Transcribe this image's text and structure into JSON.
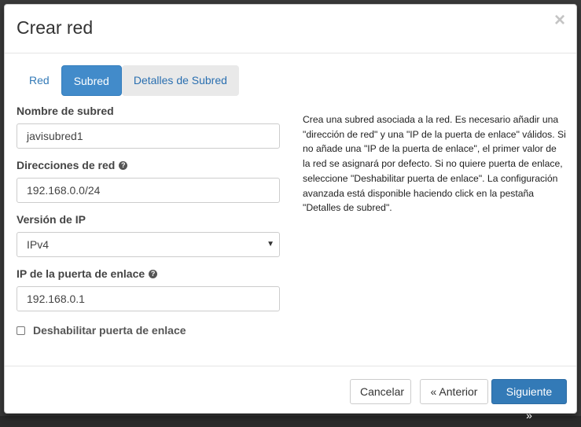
{
  "modal": {
    "title": "Crear red",
    "close_symbol": "×"
  },
  "tabs": [
    {
      "label": "Red",
      "active": false
    },
    {
      "label": "Subred",
      "active": true
    },
    {
      "label": "Detalles de Subred",
      "active": false
    }
  ],
  "form": {
    "subnet_name": {
      "label": "Nombre de subred",
      "value": "javisubred1"
    },
    "network_address": {
      "label": "Direcciones de red",
      "value": "192.168.0.0/24",
      "help_icon": "question-circle-icon"
    },
    "ip_version": {
      "label": "Versión de IP",
      "value": "IPv4"
    },
    "gateway_ip": {
      "label": "IP de la puerta de enlace",
      "value": "192.168.0.1",
      "help_icon": "question-circle-icon"
    },
    "disable_gateway": {
      "label": "Deshabilitar puerta de enlace",
      "checked": false
    }
  },
  "help_text": "Crea una subred asociada a la red. Es necesario añadir una \"dirección de red\" y una \"IP de la puerta de enlace\" válidos. Si no añade una \"IP de la puerta de enlace\", el primer valor de la red se asignará por defecto. Si no quiere puerta de enlace, seleccione \"Deshabilitar puerta de enlace\". La configuración avanzada está disponible haciendo click en la pestaña \"Detalles de subred\".",
  "footer": {
    "cancel_label": "Cancelar",
    "back_label": "« Anterior",
    "next_label": "Siguiente »"
  },
  "colors": {
    "primary": "#337ab7",
    "tab_active": "#428bca"
  }
}
